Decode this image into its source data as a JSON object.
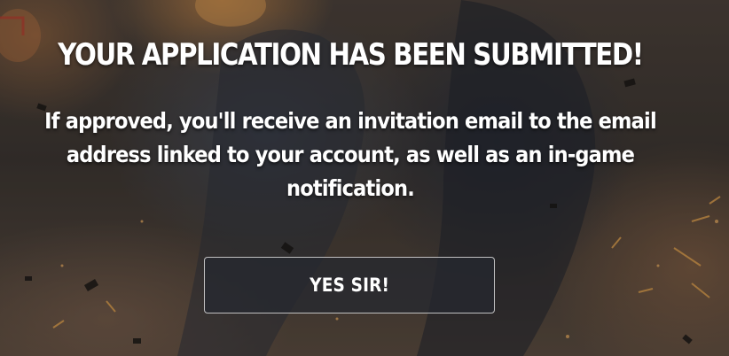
{
  "dialog": {
    "title": "YOUR APPLICATION HAS BEEN SUBMITTED!",
    "message_lines": [
      "If approved, you'll receive an invitation email to the email",
      "address linked to your account, as well as an in-game",
      "notification."
    ],
    "confirm_label": "YES SIR!"
  },
  "colors": {
    "text": "#ffffff",
    "button_border": "#dcdcdc",
    "button_fill": "#26282f"
  }
}
